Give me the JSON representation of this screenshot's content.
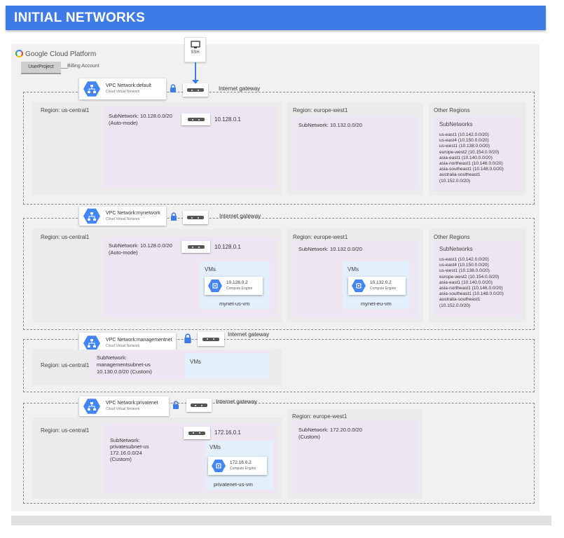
{
  "header": {
    "title": "INITIAL NETWORKS"
  },
  "platform": {
    "name": "Google Cloud Platform"
  },
  "project": {
    "name": "UserProject",
    "billing": "Billing Account"
  },
  "ssh": {
    "label": "SSH"
  },
  "labels": {
    "cloud_virtual_network": "Cloud Virtual Network",
    "internet_gateway": "Internet gateway",
    "vms": "VMs",
    "compute_engine": "Compute Engine",
    "subnetworks": "SubNetworks",
    "other_regions": "Other Regions"
  },
  "networks": {
    "default": {
      "title": "VPC Network:default",
      "region_central": "Region: us-central1",
      "subnet_central": "SubNetwork: 10.128.0.0/20",
      "subnet_central_mode": "(Auto-mode)",
      "ip_central": "10.128.0.1",
      "region_eu": "Region: europe-west1",
      "subnet_eu": "SubNetwork: 10.132.0.0/20",
      "other_regions_list": "us-east1 (10.142.0.0/20)\nus-east4 (10.150.0.0/20)\nus-west1 (10.138.0.0/20)\neurope-west2 (10.154.0.0/20)\nasia-east1 (10.140.0.0/20)\nasia-northeast1 (10.146.0.0/20)\nasia-southeast1 (10.148.0.0/20)\naustralia-southeast1\n(10.152.0.0/20)"
    },
    "mynetwork": {
      "title": "VPC Network:mynetwork",
      "region_central": "Region: us-central1",
      "subnet_central": "SubNetwork: 10.128.0.0/20",
      "subnet_central_mode": "(Auto-mode)",
      "ip_central": "10.128.0.1",
      "vm_us_ip": "10.128.0.2",
      "vm_us_name": "mynet-us-vm",
      "region_eu": "Region: europe-west1",
      "subnet_eu": "SubNetwork: 10.132.0.0/20",
      "vm_eu_ip": "10.132.0.2",
      "vm_eu_name": "mynet-eu-vm",
      "other_regions_list": "us-east1 (10.142.0.0/20)\nus-east4 (10.150.0.0/20)\nus-west1 (10.138.0.0/20)\neurope-west2 (10.154.0.0/20)\nasia-east1 (10.140.0.0/20)\nasia-northeast1 (10.146.0.0/20)\nasia-southeast1 (10.148.0.0/20)\naustralia-southeast1\n(10.152.0.0/20)"
    },
    "managementnet": {
      "title": "VPC Network:managementnet",
      "region_central": "Region: us-central1",
      "subnet_line1": "SubNetwork:",
      "subnet_line2": "managementsubnet-us",
      "subnet_line3": "10.130.0.0/20 (Custom)"
    },
    "privatenet": {
      "title": "VPC Network:privatenet",
      "region_central": "Region: us-central1",
      "subnet_line1": "SubNetwork:",
      "subnet_line2": "privatesubnet-us",
      "subnet_line3": "172.16.0.0/24",
      "subnet_line4": "(Custom)",
      "ip_central": "172.16.0.1",
      "vm_ip": "172.16.0.2",
      "vm_name": "privatenet-us-vm",
      "region_eu": "Region: europe-west1",
      "subnet_eu": "SubNetwork: 172.20.0.0/20",
      "subnet_eu_mode": "(Custom)"
    }
  },
  "colors": {
    "header": "#3f7be6",
    "gcp_blue": "#4285f4",
    "region_bg": "#ebebeb",
    "subnet_bg": "#ede6f2",
    "vms_bg": "#e3effa"
  }
}
